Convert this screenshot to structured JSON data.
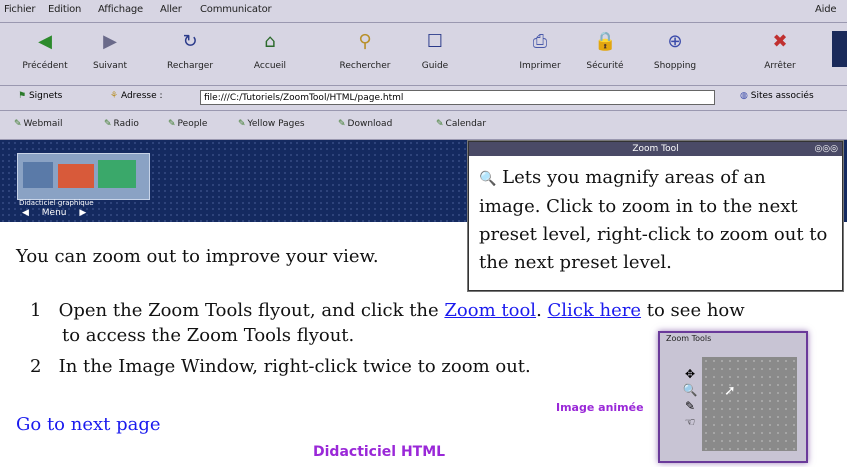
{
  "menubar": {
    "items": [
      "Fichier",
      "Edition",
      "Affichage",
      "Aller",
      "Communicator"
    ],
    "right": "Aide"
  },
  "toolbar": {
    "buttons": [
      {
        "label": "Précédent",
        "icon": "back-icon"
      },
      {
        "label": "Suivant",
        "icon": "forward-icon"
      },
      {
        "label": "Recharger",
        "icon": "reload-icon"
      },
      {
        "label": "Accueil",
        "icon": "home-icon"
      },
      {
        "label": "Rechercher",
        "icon": "search-icon"
      },
      {
        "label": "Guide",
        "icon": "guide-icon"
      },
      {
        "label": "Imprimer",
        "icon": "print-icon"
      },
      {
        "label": "Sécurité",
        "icon": "security-icon"
      },
      {
        "label": "Shopping",
        "icon": "shopping-icon"
      },
      {
        "label": "Arrêter",
        "icon": "stop-icon"
      }
    ]
  },
  "address": {
    "bookmarks_label": "Signets",
    "location_label": "Adresse :",
    "url": "file:///C:/Tutoriels/ZoomTool/HTML/page.html",
    "related_label": "Sites associés"
  },
  "links": [
    "Webmail",
    "Radio",
    "People",
    "Yellow Pages",
    "Download",
    "Calendar"
  ],
  "banner": {
    "logo_caption": "Didacticiel graphique",
    "nav": [
      "◀",
      "Menu",
      "▶"
    ]
  },
  "tooltip": {
    "title": "Zoom Tool",
    "text": "Lets you magnify areas of an image. Click to zoom in to the next preset level, right-click to zoom out to the next preset level."
  },
  "content": {
    "intro": "You can zoom out to improve your view.",
    "step1_num": "1",
    "step1_a": "Open the Zoom Tools flyout, and click the",
    "step1_link1": "Zoom tool",
    "step1_link2": "Click here",
    "step1_b": "to see how",
    "step1_c": "to access the Zoom Tools flyout.",
    "step2_num": "2",
    "step2_text": "In the Image Window, right-click twice to zoom out.",
    "next_link": "Go to next page",
    "animated_label": "Image animée",
    "footer": "Didacticiel HTML"
  },
  "zoomwin": {
    "title": "Zoom Tools"
  }
}
